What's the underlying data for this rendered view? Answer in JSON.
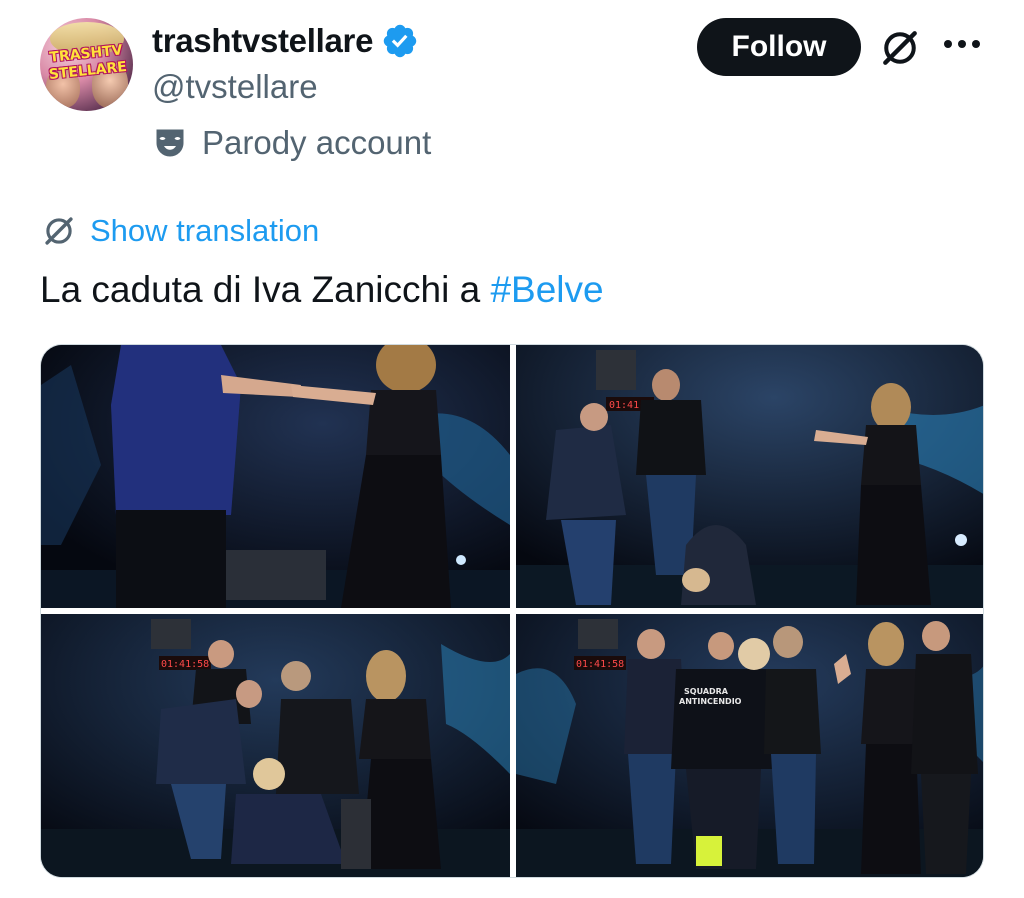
{
  "profile": {
    "display_name": "trashtvstellare",
    "handle": "@tvstellare",
    "account_label": "Parody account",
    "avatar_text_line1": "TRASHTV",
    "avatar_text_line2": "STELLARE",
    "verified": true
  },
  "actions": {
    "follow_label": "Follow"
  },
  "translate": {
    "label": "Show translation"
  },
  "tweet": {
    "text": "La caduta di Iva Zanicchi a ",
    "hashtag": "#Belve"
  },
  "media": {
    "count": 4,
    "photos": [
      {
        "description_icon": "photo-icon",
        "timecode": ""
      },
      {
        "description_icon": "photo-icon",
        "timecode": "01:41:58"
      },
      {
        "description_icon": "photo-icon",
        "timecode": "01:41:58"
      },
      {
        "description_icon": "photo-icon",
        "timecode": "01:41:58"
      }
    ],
    "jacket_text_line1": "SQUADRA",
    "jacket_text_line2": "ANTINCENDIO"
  },
  "colors": {
    "accent": "#1d9bf0",
    "text_primary": "#0f1419",
    "text_secondary": "#536471",
    "follow_bg": "#0f1419",
    "verified": "#1d9bf0"
  }
}
